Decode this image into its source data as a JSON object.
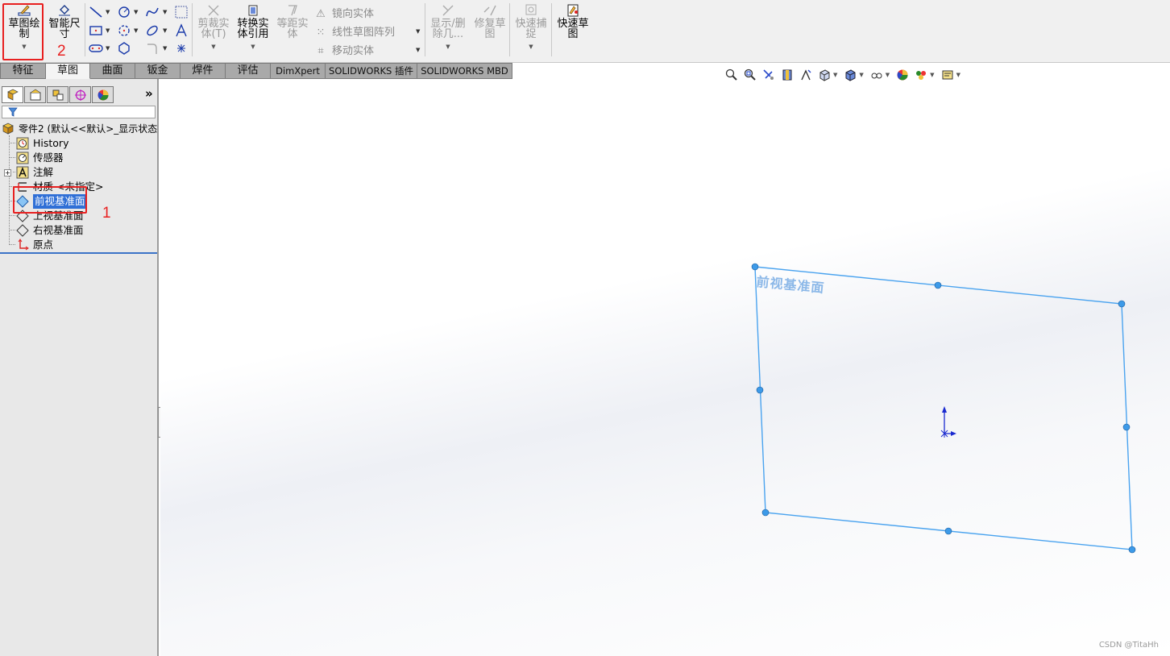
{
  "ribbon": {
    "sketch": {
      "label": "草图绘\n制"
    },
    "smart_dim": {
      "label": "智能尺\n寸"
    },
    "trim": {
      "label": "剪裁实\n体(T)"
    },
    "convert": {
      "label": "转换实\n体引用"
    },
    "offset": {
      "label": "等距实\n体"
    },
    "mirror": {
      "label": "镜向实体"
    },
    "linear_pattern": {
      "label": "线性草图阵列"
    },
    "move": {
      "label": "移动实体"
    },
    "display_delete": {
      "label": "显示/删\n除几..."
    },
    "repair": {
      "label": "修复草\n图"
    },
    "snap": {
      "label": "快速捕\n捉"
    },
    "rapid_sketch": {
      "label": "快速草\n图"
    }
  },
  "tabs": [
    {
      "label": "特征",
      "active": false
    },
    {
      "label": "草图",
      "active": true
    },
    {
      "label": "曲面",
      "active": false
    },
    {
      "label": "钣金",
      "active": false
    },
    {
      "label": "焊件",
      "active": false
    },
    {
      "label": "评估",
      "active": false
    },
    {
      "label": "DimXpert",
      "active": false
    },
    {
      "label": "SOLIDWORKS 插件",
      "active": false
    },
    {
      "label": "SOLIDWORKS MBD",
      "active": false
    }
  ],
  "panel": {
    "more": "»"
  },
  "tree": {
    "root": "零件2 (默认<<默认>_显示状态",
    "items": [
      {
        "label": "History",
        "icon": "history-icon"
      },
      {
        "label": "传感器",
        "icon": "sensor-icon"
      },
      {
        "label": "注解",
        "icon": "annotation-icon"
      },
      {
        "label": "材质 <未指定>",
        "icon": "material-icon"
      },
      {
        "label": "前视基准面",
        "icon": "plane-icon",
        "selected": true
      },
      {
        "label": "上视基准面",
        "icon": "plane-icon"
      },
      {
        "label": "右视基准面",
        "icon": "plane-icon"
      },
      {
        "label": "原点",
        "icon": "origin-icon"
      }
    ]
  },
  "graphics": {
    "plane_label": "前视基准面",
    "watermark": "CSDN @TitaHh"
  },
  "annotations": {
    "one": "1",
    "two": "2"
  },
  "colors": {
    "plane": "#4aa3ef",
    "highlight": "#e82020",
    "selection": "#2f6fd6"
  }
}
